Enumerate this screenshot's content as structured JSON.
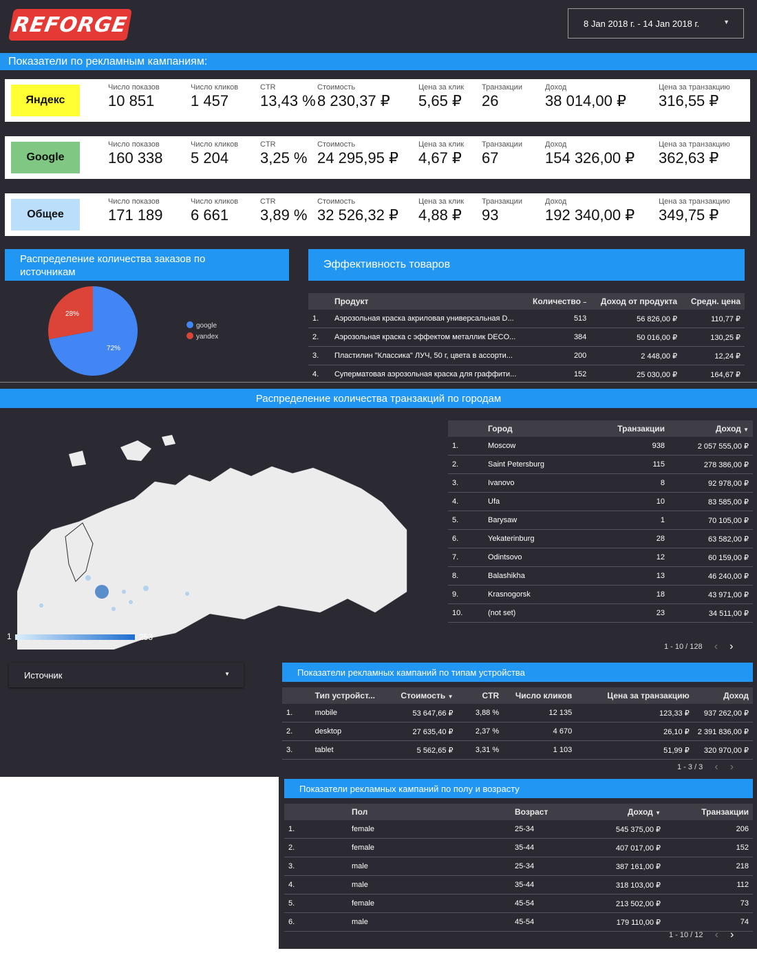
{
  "logo": "REFORGE",
  "date_range": "8 Jan 2018 г. - 14 Jan 2018 г.",
  "campaigns_title": "Показатели по рекламным кампаниям:",
  "metric_labels": [
    "Число показов",
    "Число кликов",
    "CTR",
    "Стоимость",
    "Цена за клик",
    "Транзакции",
    "Доход",
    "Цена за транзакцию"
  ],
  "campaigns": [
    {
      "name": "Яндекс",
      "color": "#ffff33",
      "values": [
        "10 851",
        "1 457",
        "13,43 %",
        "8 230,37 ₽",
        "5,65 ₽",
        "26",
        "38 014,00 ₽",
        "316,55 ₽"
      ]
    },
    {
      "name": "Google",
      "color": "#81c784",
      "values": [
        "160 338",
        "5 204",
        "3,25 %",
        "24 295,95 ₽",
        "4,67 ₽",
        "67",
        "154 326,00 ₽",
        "362,63 ₽"
      ]
    },
    {
      "name": "Общее",
      "color": "#bbdefb",
      "values": [
        "171 189",
        "6 661",
        "3,89 %",
        "32 526,32 ₽",
        "4,88 ₽",
        "93",
        "192 340,00 ₽",
        "349,75 ₽"
      ]
    }
  ],
  "pie_title": "Распределение количества заказов по источникам",
  "chart_data": {
    "type": "pie",
    "title": "",
    "categories": [
      "google",
      "yandex"
    ],
    "values": [
      72,
      28
    ],
    "labels": [
      "72%",
      "28%"
    ],
    "colors": [
      "#4285f4",
      "#db4437"
    ],
    "legend": "right"
  },
  "products_title": "Эффективность товаров",
  "products": {
    "headers": [
      "Продукт",
      "Количество",
      "Доход от продукта",
      "Средн. цена"
    ],
    "sort_icon": "sort-asc-icon",
    "rows": [
      {
        "n": "1.",
        "name": "Аэрозольная краска акриловая универсальная D...",
        "qty": "513",
        "rev": "56 826,00 ₽",
        "avg": "110,77 ₽"
      },
      {
        "n": "2.",
        "name": "Аэрозольная краска с эффектом металлик DECO...",
        "qty": "384",
        "rev": "50 016,00 ₽",
        "avg": "130,25 ₽"
      },
      {
        "n": "3.",
        "name": "Пластилин \"Классика\" ЛУЧ, 50 г, цвета в ассорти...",
        "qty": "200",
        "rev": "2 448,00 ₽",
        "avg": "12,24 ₽"
      },
      {
        "n": "4.",
        "name": "Суперматовая аэрозольная краска для граффити...",
        "qty": "152",
        "rev": "25 030,00 ₽",
        "avg": "164,67 ₽"
      }
    ]
  },
  "cities_title": "Распределение количества транзакций по городам",
  "map_legend": {
    "min": "1",
    "max": "253"
  },
  "cities": {
    "headers": [
      "Город",
      "Транзакции",
      "Доход"
    ],
    "rows": [
      {
        "n": "1.",
        "city": "Moscow",
        "tx": "938",
        "rev": "2 057 555,00 ₽"
      },
      {
        "n": "2.",
        "city": "Saint Petersburg",
        "tx": "115",
        "rev": "278 386,00 ₽"
      },
      {
        "n": "3.",
        "city": "Ivanovo",
        "tx": "8",
        "rev": "92 978,00 ₽"
      },
      {
        "n": "4.",
        "city": "Ufa",
        "tx": "10",
        "rev": "83 585,00 ₽"
      },
      {
        "n": "5.",
        "city": "Barysaw",
        "tx": "1",
        "rev": "70 105,00 ₽"
      },
      {
        "n": "6.",
        "city": "Yekaterinburg",
        "tx": "28",
        "rev": "63 582,00 ₽"
      },
      {
        "n": "7.",
        "city": "Odintsovo",
        "tx": "12",
        "rev": "60 159,00 ₽"
      },
      {
        "n": "8.",
        "city": "Balashikha",
        "tx": "13",
        "rev": "46 240,00 ₽"
      },
      {
        "n": "9.",
        "city": "Krasnogorsk",
        "tx": "18",
        "rev": "43 971,00 ₽"
      },
      {
        "n": "10.",
        "city": "(not set)",
        "tx": "23",
        "rev": "34 511,00 ₽"
      }
    ],
    "pager": "1 - 10 / 128"
  },
  "source_filter": "Источник",
  "devices_title": "Показатели рекламных кампаний по типам устройства",
  "devices": {
    "headers": [
      "Тип устройст...",
      "Стоимость",
      "CTR",
      "Число кликов",
      "Цена за транзакцию",
      "Доход"
    ],
    "rows": [
      {
        "n": "1.",
        "type": "mobile",
        "cost": "53 647,66 ₽",
        "ctr": "3,88 %",
        "clicks": "12 135",
        "cpt": "123,33 ₽",
        "rev": "937 262,00 ₽"
      },
      {
        "n": "2.",
        "type": "desktop",
        "cost": "27 635,40 ₽",
        "ctr": "2,37 %",
        "clicks": "4 670",
        "cpt": "26,10 ₽",
        "rev": "2 391 836,00 ₽"
      },
      {
        "n": "3.",
        "type": "tablet",
        "cost": "5 562,65 ₽",
        "ctr": "3,31 %",
        "clicks": "1 103",
        "cpt": "51,99 ₽",
        "rev": "320 970,00 ₽"
      }
    ],
    "pager": "1 - 3 / 3"
  },
  "demo_title": "Показатели рекламных кампаний по полу и возрасту",
  "demo": {
    "headers": [
      "Пол",
      "Возраст",
      "Доход",
      "Транзакции"
    ],
    "rows": [
      {
        "n": "1.",
        "sex": "female",
        "age": "25-34",
        "rev": "545 375,00 ₽",
        "tx": "206"
      },
      {
        "n": "2.",
        "sex": "female",
        "age": "35-44",
        "rev": "407 017,00 ₽",
        "tx": "152"
      },
      {
        "n": "3.",
        "sex": "male",
        "age": "25-34",
        "rev": "387 161,00 ₽",
        "tx": "218"
      },
      {
        "n": "4.",
        "sex": "male",
        "age": "35-44",
        "rev": "318 103,00 ₽",
        "tx": "112"
      },
      {
        "n": "5.",
        "sex": "female",
        "age": "45-54",
        "rev": "213 502,00 ₽",
        "tx": "73"
      },
      {
        "n": "6.",
        "sex": "male",
        "age": "45-54",
        "rev": "179 110,00 ₽",
        "tx": "74"
      }
    ],
    "pager": "1 - 10 / 12"
  }
}
